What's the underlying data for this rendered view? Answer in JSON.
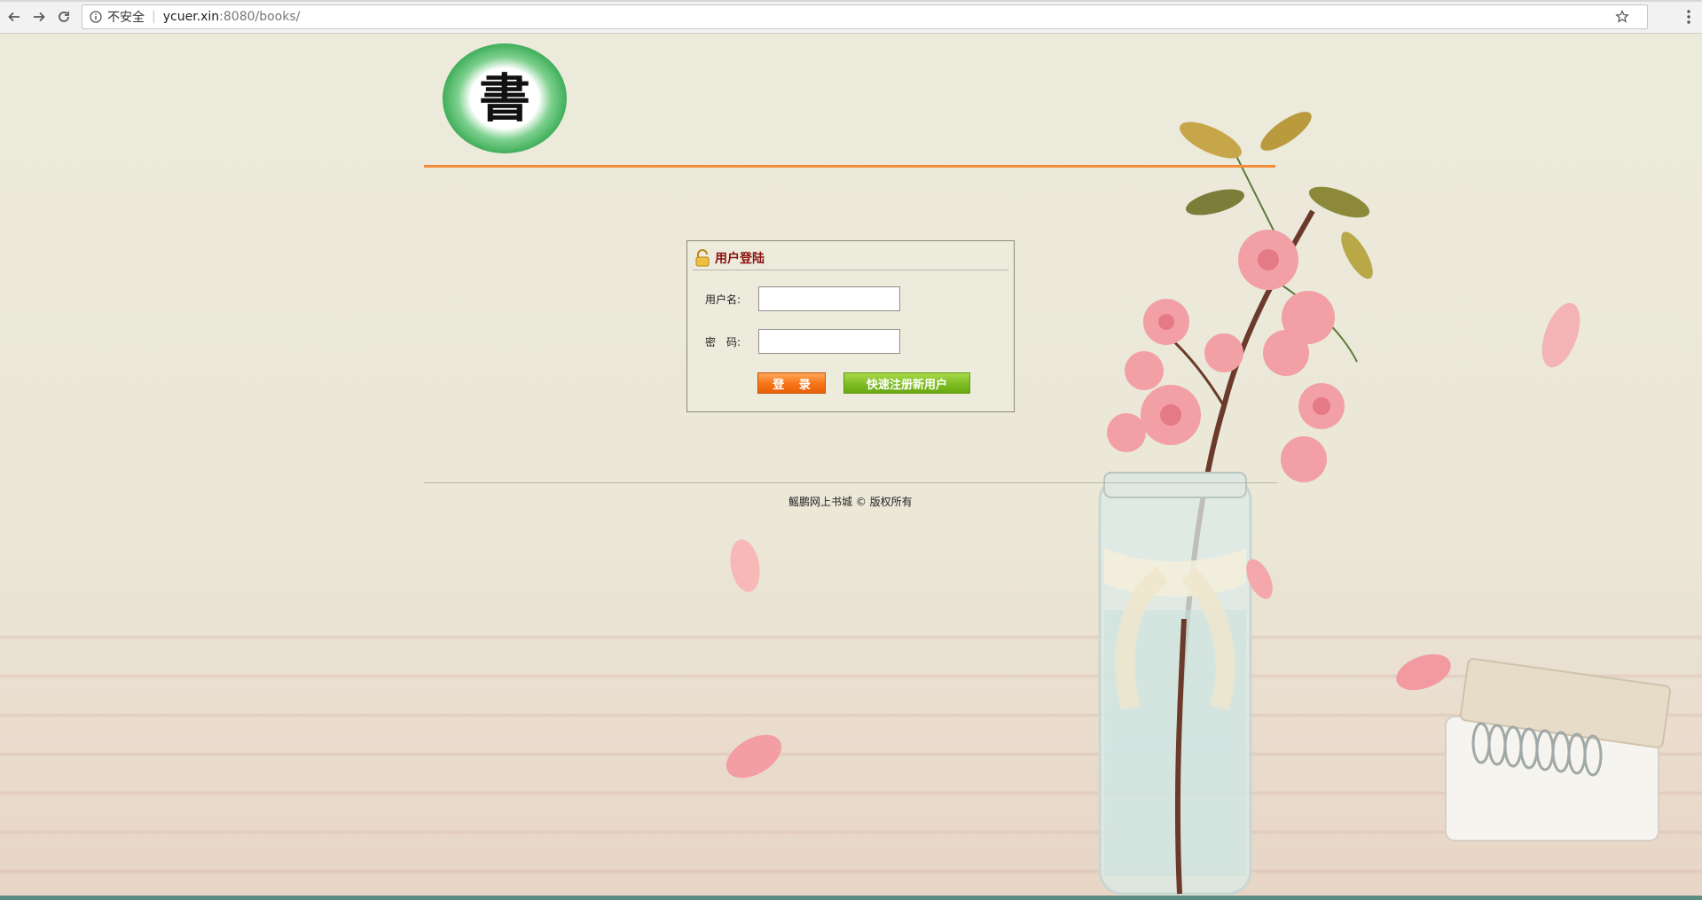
{
  "browser": {
    "security_label": "不安全",
    "url_host": "ycuer.xin",
    "url_rest": ":8080/books/"
  },
  "login": {
    "title": "用户登陆",
    "username_label": "用户名:",
    "username_value": "",
    "password_label": "密　码:",
    "password_value": "",
    "login_button": "登 录",
    "register_button": "快速注册新用户"
  },
  "footer": {
    "text": "鳐鹏网上书城 © 版权所有"
  },
  "colors": {
    "accent_orange": "#f28a3a",
    "title_red": "#8a1010",
    "register_green": "#7fbd24"
  },
  "logo": {
    "glyph": "書"
  }
}
